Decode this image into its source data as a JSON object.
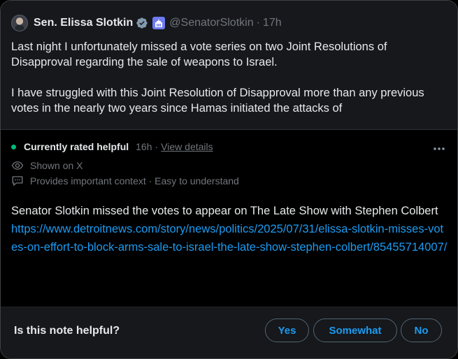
{
  "post": {
    "author_name": "Sen. Elissa Slotkin",
    "handle": "@SenatorSlotkin",
    "separator": "·",
    "time": "17h",
    "paragraphs": [
      "Last night I unfortunately missed a vote series on two Joint Resolutions of Disapproval regarding the sale of weapons to Israel.",
      "I have struggled with this Joint Resolution of Disapproval more than any previous votes in the nearly two years since Hamas initiated the attacks of"
    ],
    "icons": {
      "verified": "verified-badge-icon",
      "government": "government-affiliation-icon",
      "avatar": "avatar"
    }
  },
  "note": {
    "status_label": "Currently rated helpful",
    "status_time": "16h",
    "status_separator": "·",
    "view_details": "View details",
    "more_icon": "more-options-icon",
    "shown_on": "Shown on X",
    "context_label": "Provides important context · Easy to understand",
    "body_text": "Senator Slotkin missed the votes to appear on The Late Show with Stephen Colbert",
    "link": "https://www.detroitnews.com/story/news/politics/2025/07/31/elissa-slotkin-misses-votes-on-effort-to-block-arms-sale-to-israel-the-late-show-stephen-colbert/85455714007/",
    "status_color": "#00ba7c"
  },
  "footer": {
    "question": "Is this note helpful?",
    "yes_label": "Yes",
    "somewhat_label": "Somewhat",
    "no_label": "No"
  },
  "colors": {
    "background": "#000000",
    "panel": "#16181c",
    "text": "#e7e9ea",
    "muted": "#71767b",
    "link": "#1d9bf0",
    "border": "#3e4144"
  }
}
